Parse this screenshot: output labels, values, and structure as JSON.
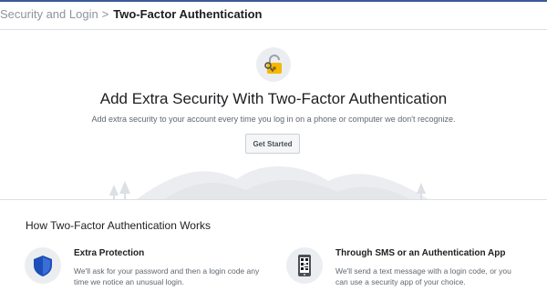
{
  "breadcrumb": {
    "parent": "Security and Login",
    "separator": ">",
    "current": "Two-Factor Authentication"
  },
  "hero": {
    "icon": "lock-key-icon",
    "title": "Add Extra Security With Two-Factor Authentication",
    "subtitle": "Add extra security to your account every time you log in on a phone or computer we don't recognize.",
    "button_label": "Get Started"
  },
  "how": {
    "title": "How Two-Factor Authentication Works",
    "features": [
      {
        "icon": "shield-icon",
        "title": "Extra Protection",
        "desc_line1": "We'll ask for your password and then a login code any",
        "desc_line2": "time we notice an unusual login."
      },
      {
        "icon": "phone-qr-icon",
        "title": "Through SMS or an Authentication App",
        "desc_line1": "We'll send a text message with a login code, or you",
        "desc_line2": "can use a security app of your choice."
      }
    ]
  },
  "colors": {
    "brand": "#3b5998",
    "lock_gold": "#f5b800",
    "shield_blue": "#1e4eb8",
    "text_primary": "#1c1e21",
    "text_secondary": "#606770"
  }
}
